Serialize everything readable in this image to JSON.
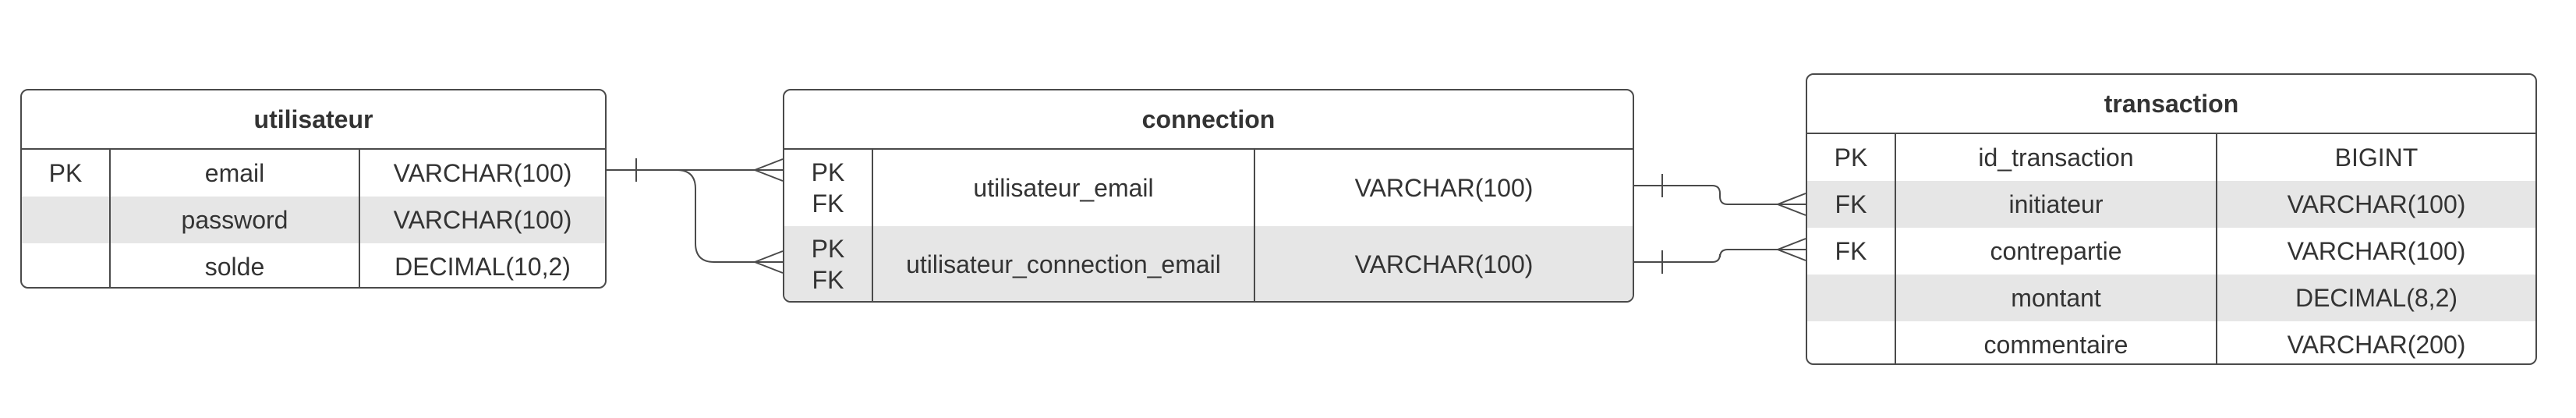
{
  "entities": {
    "utilisateur": {
      "title": "utilisateur",
      "rows": [
        {
          "key": "PK",
          "name": "email",
          "type": "VARCHAR(100)"
        },
        {
          "key": "",
          "name": "password",
          "type": "VARCHAR(100)"
        },
        {
          "key": "",
          "name": "solde",
          "type": "DECIMAL(10,2)"
        }
      ]
    },
    "connection": {
      "title": "connection",
      "rows": [
        {
          "key": "PK\nFK",
          "name": "utilisateur_email",
          "type": "VARCHAR(100)"
        },
        {
          "key": "PK\nFK",
          "name": "utilisateur_connection_email",
          "type": "VARCHAR(100)"
        }
      ]
    },
    "transaction": {
      "title": "transaction",
      "rows": [
        {
          "key": "PK",
          "name": "id_transaction",
          "type": "BIGINT"
        },
        {
          "key": "FK",
          "name": "initiateur",
          "type": "VARCHAR(100)"
        },
        {
          "key": "FK",
          "name": "contrepartie",
          "type": "VARCHAR(100)"
        },
        {
          "key": "",
          "name": "montant",
          "type": "DECIMAL(8,2)"
        },
        {
          "key": "",
          "name": "commentaire",
          "type": "VARCHAR(200)"
        }
      ]
    }
  },
  "relationships": [
    {
      "from": "utilisateur.email",
      "to": "connection.utilisateur_email",
      "from_cardinality": "one",
      "to_cardinality": "many"
    },
    {
      "from": "utilisateur.email",
      "to": "connection.utilisateur_connection_email",
      "from_cardinality": "one",
      "to_cardinality": "many"
    },
    {
      "from": "connection.utilisateur_email",
      "to": "transaction.initiateur",
      "from_cardinality": "one",
      "to_cardinality": "many"
    },
    {
      "from": "connection.utilisateur_connection_email",
      "to": "transaction.contrepartie",
      "from_cardinality": "one",
      "to_cardinality": "many"
    }
  ],
  "colors": {
    "border": "#4a4a4a",
    "text": "#333333",
    "shaded_row": "#e6e6e6",
    "background": "#ffffff"
  }
}
